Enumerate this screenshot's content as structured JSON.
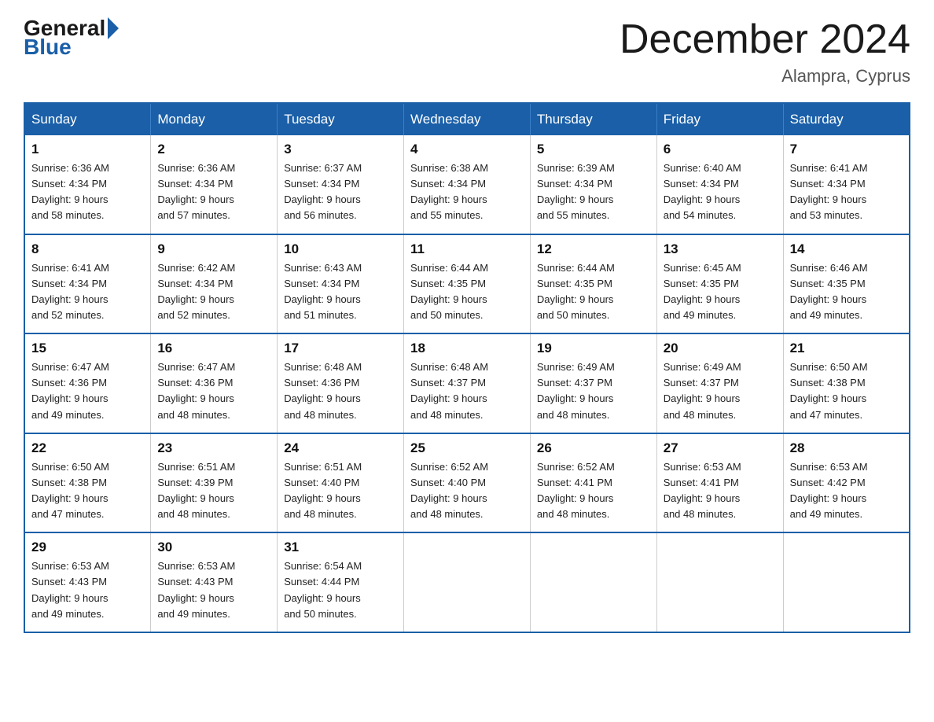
{
  "logo": {
    "general": "General",
    "blue": "Blue"
  },
  "title": {
    "month_year": "December 2024",
    "location": "Alampra, Cyprus"
  },
  "days_of_week": [
    "Sunday",
    "Monday",
    "Tuesday",
    "Wednesday",
    "Thursday",
    "Friday",
    "Saturday"
  ],
  "weeks": [
    [
      {
        "num": "1",
        "sunrise": "6:36 AM",
        "sunset": "4:34 PM",
        "daylight": "9 hours and 58 minutes."
      },
      {
        "num": "2",
        "sunrise": "6:36 AM",
        "sunset": "4:34 PM",
        "daylight": "9 hours and 57 minutes."
      },
      {
        "num": "3",
        "sunrise": "6:37 AM",
        "sunset": "4:34 PM",
        "daylight": "9 hours and 56 minutes."
      },
      {
        "num": "4",
        "sunrise": "6:38 AM",
        "sunset": "4:34 PM",
        "daylight": "9 hours and 55 minutes."
      },
      {
        "num": "5",
        "sunrise": "6:39 AM",
        "sunset": "4:34 PM",
        "daylight": "9 hours and 55 minutes."
      },
      {
        "num": "6",
        "sunrise": "6:40 AM",
        "sunset": "4:34 PM",
        "daylight": "9 hours and 54 minutes."
      },
      {
        "num": "7",
        "sunrise": "6:41 AM",
        "sunset": "4:34 PM",
        "daylight": "9 hours and 53 minutes."
      }
    ],
    [
      {
        "num": "8",
        "sunrise": "6:41 AM",
        "sunset": "4:34 PM",
        "daylight": "9 hours and 52 minutes."
      },
      {
        "num": "9",
        "sunrise": "6:42 AM",
        "sunset": "4:34 PM",
        "daylight": "9 hours and 52 minutes."
      },
      {
        "num": "10",
        "sunrise": "6:43 AM",
        "sunset": "4:34 PM",
        "daylight": "9 hours and 51 minutes."
      },
      {
        "num": "11",
        "sunrise": "6:44 AM",
        "sunset": "4:35 PM",
        "daylight": "9 hours and 50 minutes."
      },
      {
        "num": "12",
        "sunrise": "6:44 AM",
        "sunset": "4:35 PM",
        "daylight": "9 hours and 50 minutes."
      },
      {
        "num": "13",
        "sunrise": "6:45 AM",
        "sunset": "4:35 PM",
        "daylight": "9 hours and 49 minutes."
      },
      {
        "num": "14",
        "sunrise": "6:46 AM",
        "sunset": "4:35 PM",
        "daylight": "9 hours and 49 minutes."
      }
    ],
    [
      {
        "num": "15",
        "sunrise": "6:47 AM",
        "sunset": "4:36 PM",
        "daylight": "9 hours and 49 minutes."
      },
      {
        "num": "16",
        "sunrise": "6:47 AM",
        "sunset": "4:36 PM",
        "daylight": "9 hours and 48 minutes."
      },
      {
        "num": "17",
        "sunrise": "6:48 AM",
        "sunset": "4:36 PM",
        "daylight": "9 hours and 48 minutes."
      },
      {
        "num": "18",
        "sunrise": "6:48 AM",
        "sunset": "4:37 PM",
        "daylight": "9 hours and 48 minutes."
      },
      {
        "num": "19",
        "sunrise": "6:49 AM",
        "sunset": "4:37 PM",
        "daylight": "9 hours and 48 minutes."
      },
      {
        "num": "20",
        "sunrise": "6:49 AM",
        "sunset": "4:37 PM",
        "daylight": "9 hours and 48 minutes."
      },
      {
        "num": "21",
        "sunrise": "6:50 AM",
        "sunset": "4:38 PM",
        "daylight": "9 hours and 47 minutes."
      }
    ],
    [
      {
        "num": "22",
        "sunrise": "6:50 AM",
        "sunset": "4:38 PM",
        "daylight": "9 hours and 47 minutes."
      },
      {
        "num": "23",
        "sunrise": "6:51 AM",
        "sunset": "4:39 PM",
        "daylight": "9 hours and 48 minutes."
      },
      {
        "num": "24",
        "sunrise": "6:51 AM",
        "sunset": "4:40 PM",
        "daylight": "9 hours and 48 minutes."
      },
      {
        "num": "25",
        "sunrise": "6:52 AM",
        "sunset": "4:40 PM",
        "daylight": "9 hours and 48 minutes."
      },
      {
        "num": "26",
        "sunrise": "6:52 AM",
        "sunset": "4:41 PM",
        "daylight": "9 hours and 48 minutes."
      },
      {
        "num": "27",
        "sunrise": "6:53 AM",
        "sunset": "4:41 PM",
        "daylight": "9 hours and 48 minutes."
      },
      {
        "num": "28",
        "sunrise": "6:53 AM",
        "sunset": "4:42 PM",
        "daylight": "9 hours and 49 minutes."
      }
    ],
    [
      {
        "num": "29",
        "sunrise": "6:53 AM",
        "sunset": "4:43 PM",
        "daylight": "9 hours and 49 minutes."
      },
      {
        "num": "30",
        "sunrise": "6:53 AM",
        "sunset": "4:43 PM",
        "daylight": "9 hours and 49 minutes."
      },
      {
        "num": "31",
        "sunrise": "6:54 AM",
        "sunset": "4:44 PM",
        "daylight": "9 hours and 50 minutes."
      },
      null,
      null,
      null,
      null
    ]
  ],
  "labels": {
    "sunrise": "Sunrise:",
    "sunset": "Sunset:",
    "daylight": "Daylight:"
  }
}
